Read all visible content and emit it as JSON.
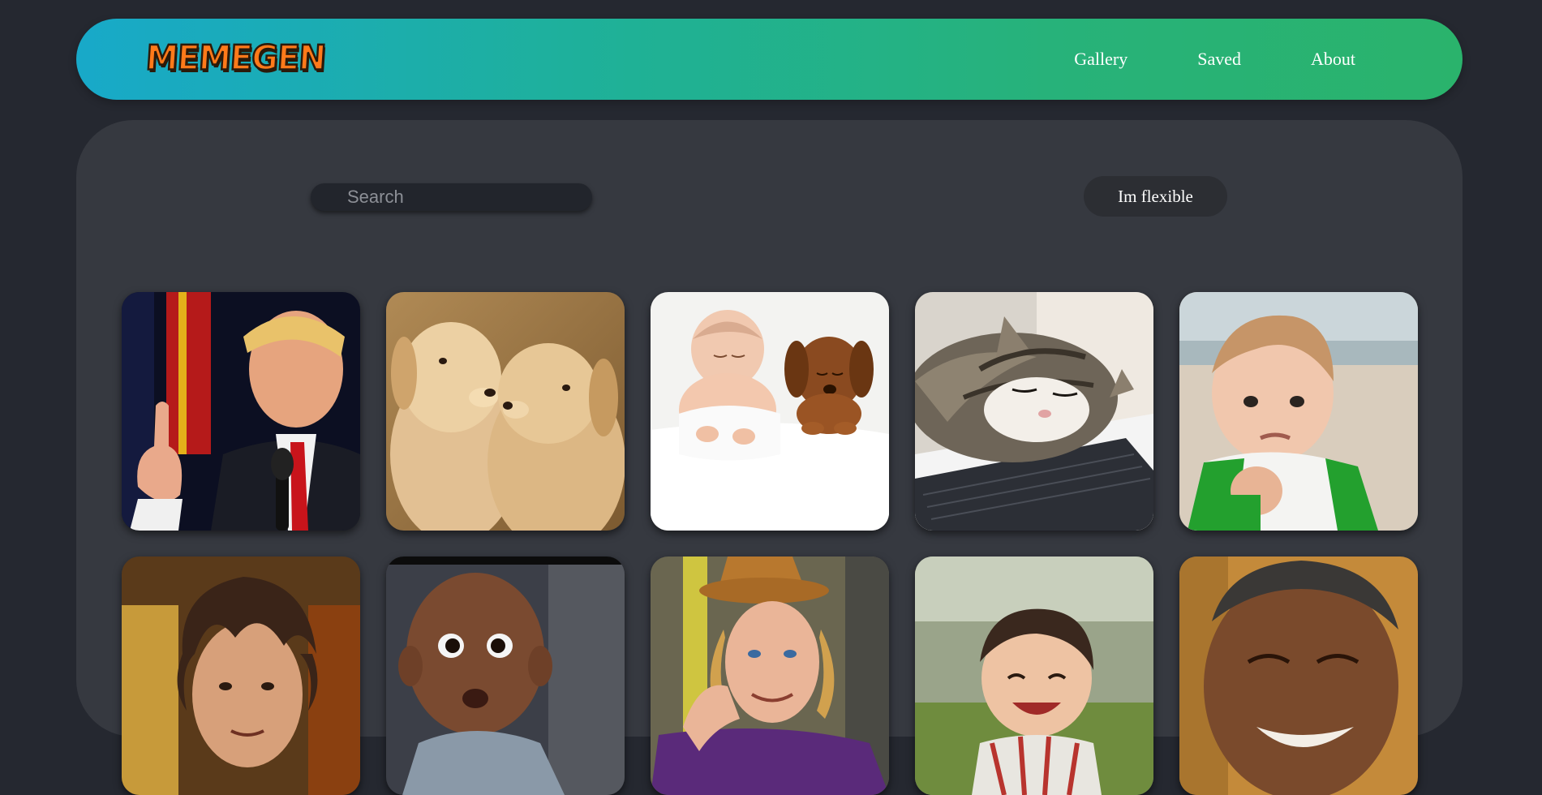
{
  "header": {
    "logo": "MEMEGEN",
    "nav": [
      "Gallery",
      "Saved",
      "About"
    ]
  },
  "search": {
    "placeholder": "Search",
    "value": ""
  },
  "flexible_button": "Im flexible",
  "gallery": [
    {
      "subject": "man-pointing-finger"
    },
    {
      "subject": "two-puppies"
    },
    {
      "subject": "baby-and-puppy-sleeping"
    },
    {
      "subject": "cat-on-laptop"
    },
    {
      "subject": "success-kid"
    },
    {
      "subject": "aliens-guy"
    },
    {
      "subject": "surprised-baby"
    },
    {
      "subject": "condescending-wonka"
    },
    {
      "subject": "evil-toddler"
    },
    {
      "subject": "laughing-man"
    }
  ],
  "colors": {
    "page_bg": "#252830",
    "panel_bg": "#363940",
    "header_start": "#18a9c9",
    "header_end": "#2ab36c",
    "logo": "#ff7a1a"
  }
}
